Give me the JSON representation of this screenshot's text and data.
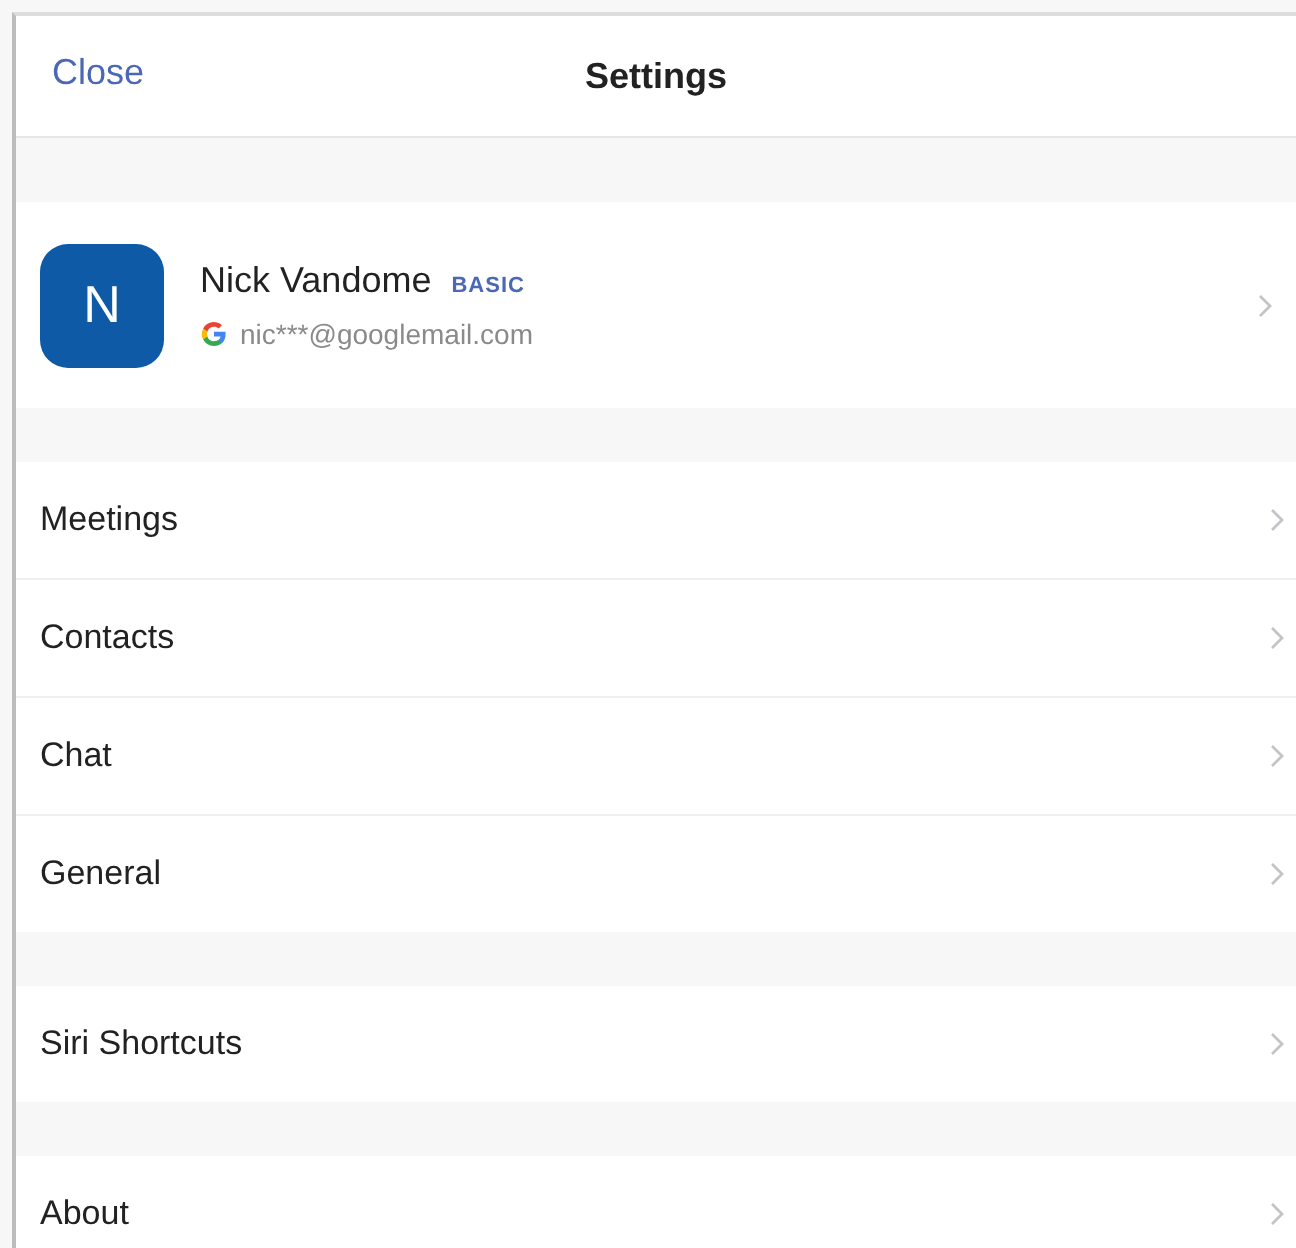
{
  "header": {
    "close": "Close",
    "title": "Settings"
  },
  "profile": {
    "initial": "N",
    "name": "Nick Vandome",
    "plan": "BASIC",
    "email": "nic***@googlemail.com"
  },
  "sections": [
    {
      "items": [
        {
          "label": "Meetings"
        },
        {
          "label": "Contacts"
        },
        {
          "label": "Chat"
        },
        {
          "label": "General"
        }
      ]
    },
    {
      "items": [
        {
          "label": "Siri Shortcuts"
        }
      ]
    },
    {
      "items": [
        {
          "label": "About"
        }
      ]
    }
  ]
}
